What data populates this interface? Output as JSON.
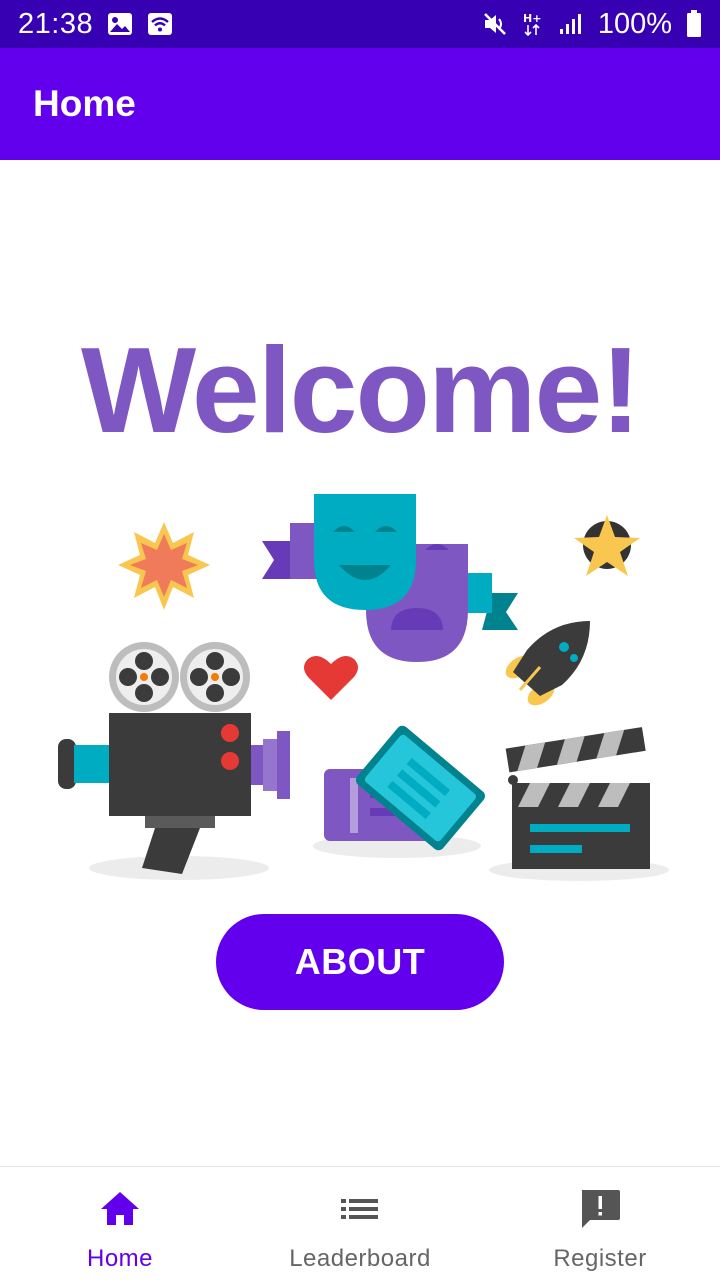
{
  "status_bar": {
    "time": "21:38",
    "battery": "100%",
    "icons": [
      "image-icon",
      "wifi-icon",
      "mute-icon",
      "h-plus-icon",
      "signal-icon",
      "battery-icon"
    ]
  },
  "app_bar": {
    "title": "Home"
  },
  "main": {
    "heading": "Welcome!",
    "about_button": "ABOUT",
    "illustration_icons": [
      "explosion-icon",
      "theater-masks-icon",
      "star-icon",
      "heart-icon",
      "rocket-icon",
      "film-camera-icon",
      "tickets-icon",
      "clapperboard-icon"
    ]
  },
  "bottom_nav": {
    "items": [
      {
        "label": "Home",
        "icon": "home-icon",
        "active": true
      },
      {
        "label": "Leaderboard",
        "icon": "list-icon",
        "active": false
      },
      {
        "label": "Register",
        "icon": "feedback-icon",
        "active": false
      }
    ]
  },
  "colors": {
    "status_bar": "#3700b3",
    "primary": "#6200ee",
    "welcome_text": "#7e57c2",
    "nav_inactive": "#666666"
  }
}
